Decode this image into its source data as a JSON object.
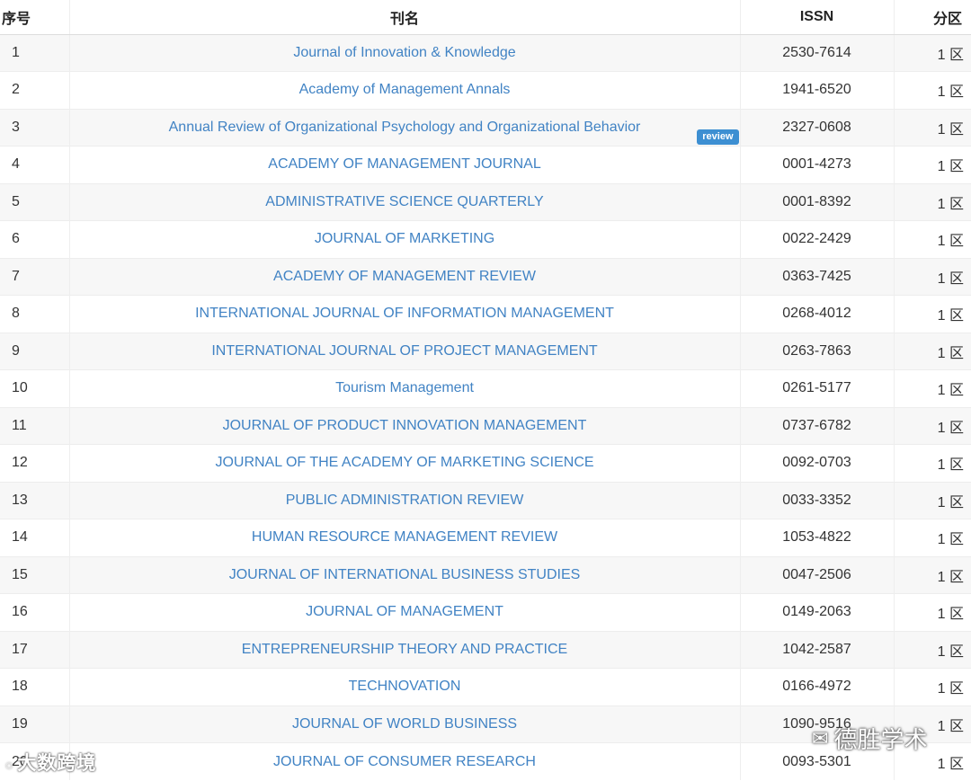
{
  "header": {
    "index": "序号",
    "title": "刊名",
    "issn": "ISSN",
    "zone": "分区"
  },
  "rows": [
    {
      "index": "1",
      "title": "Journal of Innovation & Knowledge",
      "issn": "2530-7614",
      "zone": "1 区"
    },
    {
      "index": "2",
      "title": "Academy of Management Annals",
      "issn": "1941-6520",
      "zone": "1 区"
    },
    {
      "index": "3",
      "title": "Annual Review of Organizational Psychology and Organizational Behavior",
      "issn": "2327-0608",
      "zone": "1 区",
      "badge": "review"
    },
    {
      "index": "4",
      "title": "ACADEMY OF MANAGEMENT JOURNAL",
      "issn": "0001-4273",
      "zone": "1 区"
    },
    {
      "index": "5",
      "title": "ADMINISTRATIVE SCIENCE QUARTERLY",
      "issn": "0001-8392",
      "zone": "1 区"
    },
    {
      "index": "6",
      "title": "JOURNAL OF MARKETING",
      "issn": "0022-2429",
      "zone": "1 区"
    },
    {
      "index": "7",
      "title": "ACADEMY OF MANAGEMENT REVIEW",
      "issn": "0363-7425",
      "zone": "1 区"
    },
    {
      "index": "8",
      "title": "INTERNATIONAL JOURNAL OF INFORMATION MANAGEMENT",
      "issn": "0268-4012",
      "zone": "1 区"
    },
    {
      "index": "9",
      "title": "INTERNATIONAL JOURNAL OF PROJECT MANAGEMENT",
      "issn": "0263-7863",
      "zone": "1 区"
    },
    {
      "index": "10",
      "title": "Tourism Management",
      "issn": "0261-5177",
      "zone": "1 区"
    },
    {
      "index": "11",
      "title": "JOURNAL OF PRODUCT INNOVATION MANAGEMENT",
      "issn": "0737-6782",
      "zone": "1 区"
    },
    {
      "index": "12",
      "title": "JOURNAL OF THE ACADEMY OF MARKETING SCIENCE",
      "issn": "0092-0703",
      "zone": "1 区"
    },
    {
      "index": "13",
      "title": "PUBLIC ADMINISTRATION REVIEW",
      "issn": "0033-3352",
      "zone": "1 区"
    },
    {
      "index": "14",
      "title": "HUMAN RESOURCE MANAGEMENT REVIEW",
      "issn": "1053-4822",
      "zone": "1 区"
    },
    {
      "index": "15",
      "title": "JOURNAL OF INTERNATIONAL BUSINESS STUDIES",
      "issn": "0047-2506",
      "zone": "1 区"
    },
    {
      "index": "16",
      "title": "JOURNAL OF MANAGEMENT",
      "issn": "0149-2063",
      "zone": "1 区"
    },
    {
      "index": "17",
      "title": "ENTREPRENEURSHIP THEORY AND PRACTICE",
      "issn": "1042-2587",
      "zone": "1 区"
    },
    {
      "index": "18",
      "title": "TECHNOVATION",
      "issn": "0166-4972",
      "zone": "1 区"
    },
    {
      "index": "19",
      "title": "JOURNAL OF WORLD BUSINESS",
      "issn": "1090-9516",
      "zone": "1 区"
    },
    {
      "index": "20",
      "title": "JOURNAL OF CONSUMER RESEARCH",
      "issn": "0093-5301",
      "zone": "1 区"
    }
  ],
  "watermarks": {
    "left_text": "大数跨境",
    "right_text": "德胜学术",
    "left_icon": "weibo-icon",
    "right_icon": "wechat-icon"
  },
  "colors": {
    "link": "#4183c4",
    "badge": "#3d8fd2",
    "stripe": "#f7f7f7"
  }
}
